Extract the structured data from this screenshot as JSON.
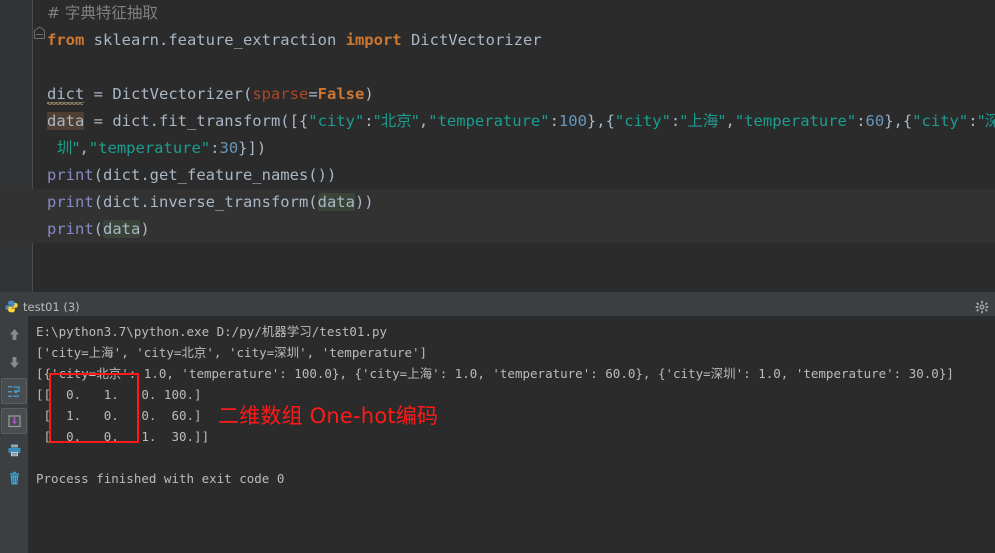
{
  "editor": {
    "fold_marker_icon": "code-fold-marker",
    "lines": [
      {
        "id": "l1",
        "highlight": false,
        "tokens": [
          {
            "cls": "tk-comment tk-zh",
            "text": "# 字典特征抽取"
          }
        ]
      },
      {
        "id": "l2",
        "highlight": false,
        "tokens": [
          {
            "cls": "tk-kw",
            "text": "from"
          },
          {
            "cls": "tk-plain",
            "text": " sklearn.feature_extraction "
          },
          {
            "cls": "tk-kw",
            "text": "import"
          },
          {
            "cls": "tk-plain",
            "text": " DictVectorizer"
          }
        ]
      },
      {
        "id": "l3",
        "highlight": false,
        "tokens": [
          {
            "cls": "tk-plain",
            "text": ""
          }
        ]
      },
      {
        "id": "l4",
        "highlight": false,
        "tokens": [
          {
            "cls": "tk-plain underline-w",
            "text": "dict"
          },
          {
            "cls": "tk-plain",
            "text": " = DictVectorizer("
          },
          {
            "cls": "tk-named",
            "text": "sparse"
          },
          {
            "cls": "tk-plain",
            "text": "="
          },
          {
            "cls": "tk-kw",
            "text": "False"
          },
          {
            "cls": "tk-plain",
            "text": ")"
          }
        ]
      },
      {
        "id": "l5",
        "highlight": false,
        "tokens": [
          {
            "cls": "tk-plain hl-brown",
            "text": "data"
          },
          {
            "cls": "tk-plain",
            "text": " = dict.fit_transform([{"
          },
          {
            "cls": "tk-str",
            "text": "\"city\""
          },
          {
            "cls": "tk-plain",
            "text": ":"
          },
          {
            "cls": "tk-str tk-zh",
            "text": "\"北京\""
          },
          {
            "cls": "tk-plain",
            "text": ","
          },
          {
            "cls": "tk-str",
            "text": "\"temperature\""
          },
          {
            "cls": "tk-plain",
            "text": ":"
          },
          {
            "cls": "tk-num",
            "text": "100"
          },
          {
            "cls": "tk-plain",
            "text": "},{"
          },
          {
            "cls": "tk-str",
            "text": "\"city\""
          },
          {
            "cls": "tk-plain",
            "text": ":"
          },
          {
            "cls": "tk-str tk-zh",
            "text": "\"上海\""
          },
          {
            "cls": "tk-plain",
            "text": ","
          },
          {
            "cls": "tk-str",
            "text": "\"temperature\""
          },
          {
            "cls": "tk-plain",
            "text": ":"
          },
          {
            "cls": "tk-num",
            "text": "60"
          },
          {
            "cls": "tk-plain",
            "text": "},{"
          },
          {
            "cls": "tk-str",
            "text": "\"city\""
          },
          {
            "cls": "tk-plain",
            "text": ":"
          },
          {
            "cls": "tk-str tk-zh",
            "text": "\"深"
          }
        ]
      },
      {
        "id": "l6",
        "highlight": false,
        "indent": true,
        "tokens": [
          {
            "cls": "tk-str tk-zh",
            "text": "  圳\""
          },
          {
            "cls": "tk-plain",
            "text": ","
          },
          {
            "cls": "tk-str",
            "text": "\"temperature\""
          },
          {
            "cls": "tk-plain",
            "text": ":"
          },
          {
            "cls": "tk-num",
            "text": "30"
          },
          {
            "cls": "tk-plain",
            "text": "}])"
          }
        ]
      },
      {
        "id": "l7",
        "highlight": false,
        "tokens": [
          {
            "cls": "tk-func",
            "text": "print"
          },
          {
            "cls": "tk-plain",
            "text": "(dict.get_feature_names())"
          }
        ]
      },
      {
        "id": "l8",
        "highlight": true,
        "tokens": [
          {
            "cls": "tk-func",
            "text": "print"
          },
          {
            "cls": "tk-plain",
            "text": "(dict.inverse_transform("
          },
          {
            "cls": "tk-plain hl-green",
            "text": "data"
          },
          {
            "cls": "tk-plain",
            "text": "))"
          }
        ]
      },
      {
        "id": "l9",
        "highlight": true,
        "tokens": [
          {
            "cls": "tk-func",
            "text": "print"
          },
          {
            "cls": "tk-plain",
            "text": "("
          },
          {
            "cls": "tk-plain hl-green",
            "text": "data"
          },
          {
            "cls": "tk-plain",
            "text": ")"
          }
        ]
      }
    ]
  },
  "console": {
    "tab": {
      "icon": "python-file-icon",
      "label": "test01 (3)"
    },
    "settings_icon": "gear-icon",
    "toolbar": [
      {
        "name": "scroll-up-button",
        "icon": "arrow-up-icon",
        "framed": false
      },
      {
        "name": "scroll-down-button",
        "icon": "arrow-down-icon",
        "framed": false
      },
      {
        "name": "soft-wrap-button",
        "icon": "soft-wrap-icon",
        "framed": true
      },
      {
        "name": "scroll-to-end-button",
        "icon": "scroll-to-end-icon",
        "framed": true
      },
      {
        "name": "print-button",
        "icon": "printer-icon",
        "framed": false
      },
      {
        "name": "clear-all-button",
        "icon": "trash-icon",
        "framed": false
      }
    ],
    "output_lines": [
      "E:\\python3.7\\python.exe D:/py/机器学习/test01.py",
      "['city=上海', 'city=北京', 'city=深圳', 'temperature']",
      "[{'city=北京': 1.0, 'temperature': 100.0}, {'city=上海': 1.0, 'temperature': 60.0}, {'city=深圳': 1.0, 'temperature': 30.0}]",
      "[[  0.   1.   0. 100.]",
      " [  1.   0.   0.  60.]",
      " [  0.   0.   1.  30.]]",
      "",
      "Process finished with exit code 0"
    ]
  },
  "annotation": {
    "text": "二维数组 One-hot编码",
    "color": "#FF1A1A",
    "box_name": "one-hot-matrix-highlight-box"
  },
  "colors": {
    "editor_bg": "#2B2B2B",
    "gutter_bg": "#313335",
    "panel_bg": "#3C3F41",
    "console_bg": "#2B2B2B",
    "keyword": "#CC7832",
    "string": "#1A9E8F",
    "number": "#6897BB",
    "function": "#8888C6",
    "named_arg": "#AA4926",
    "text": "#A9B7C6",
    "annotation_red": "#FF1A1A"
  }
}
